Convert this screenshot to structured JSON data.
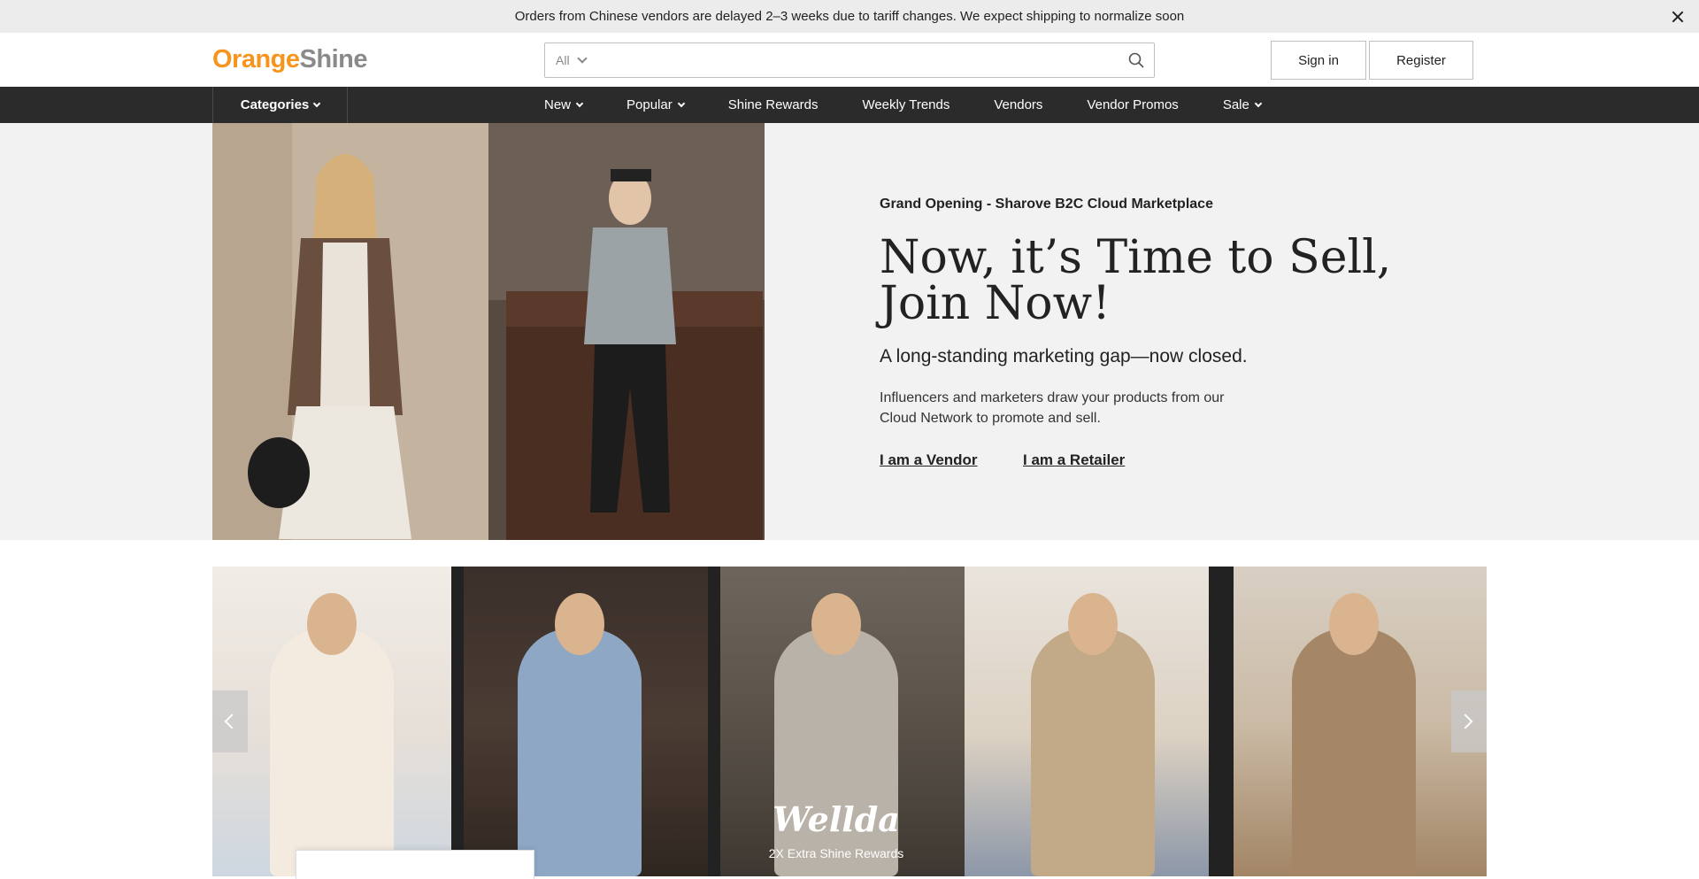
{
  "announcement": {
    "text": "Orders from Chinese vendors are delayed 2–3 weeks due to tariff changes. We expect shipping to normalize soon",
    "close_icon": "close-icon"
  },
  "header": {
    "logo_part1": "Orange",
    "logo_part2": "Shine",
    "search_scope": "All",
    "search_placeholder": "",
    "search_icon": "search-icon",
    "signin_label": "Sign in",
    "register_label": "Register"
  },
  "nav": {
    "categories_label": "Categories",
    "items": [
      {
        "label": "New",
        "has_dropdown": true
      },
      {
        "label": "Popular",
        "has_dropdown": true
      },
      {
        "label": "Shine Rewards",
        "has_dropdown": false
      },
      {
        "label": "Weekly Trends",
        "has_dropdown": false
      },
      {
        "label": "Vendors",
        "has_dropdown": false
      },
      {
        "label": "Vendor Promos",
        "has_dropdown": false
      },
      {
        "label": "Sale",
        "has_dropdown": true
      }
    ]
  },
  "hero": {
    "kicker": "Grand Opening - Sharove B2C Cloud Marketplace",
    "title": "Now, it’s Time to Sell, Join Now!",
    "subtitle": "A long-standing marketing gap—now closed.",
    "description": "Influencers and marketers draw your products from our Cloud Network to promote and sell.",
    "link_vendor": "I am a Vendor",
    "link_retailer": "I am a Retailer"
  },
  "carousel": {
    "brand": "Wellda",
    "caption": "2X Extra Shine Rewards",
    "prev_icon": "chevron-left-icon",
    "next_icon": "chevron-right-icon"
  },
  "colors": {
    "accent_orange": "#f7941d",
    "nav_bg": "#2b2b2b",
    "announce_bg": "#ececec",
    "hero_bg": "#f2f2f2"
  }
}
